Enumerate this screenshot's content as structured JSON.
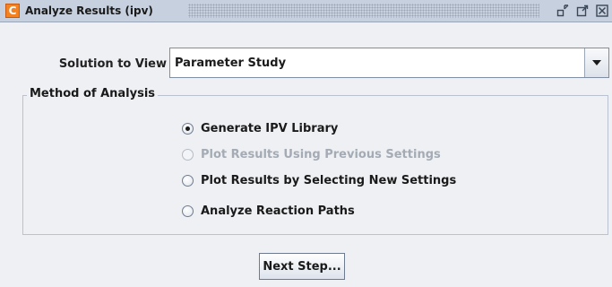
{
  "window": {
    "title": "Analyze Results  (ipv)",
    "app_icon_letter": "C",
    "accent_color": "#f58220"
  },
  "solution": {
    "label": "Solution to View",
    "selected": "Parameter Study"
  },
  "method_group": {
    "title": "Method of Analysis",
    "options": [
      {
        "label": "Generate IPV Library",
        "checked": true,
        "enabled": true
      },
      {
        "label": "Plot Results Using Previous Settings",
        "checked": false,
        "enabled": false
      },
      {
        "label": "Plot Results by Selecting New Settings",
        "checked": false,
        "enabled": true
      },
      {
        "label": "Analyze Reaction Paths",
        "checked": false,
        "enabled": true
      }
    ]
  },
  "actions": {
    "next_label": "Next Step..."
  }
}
